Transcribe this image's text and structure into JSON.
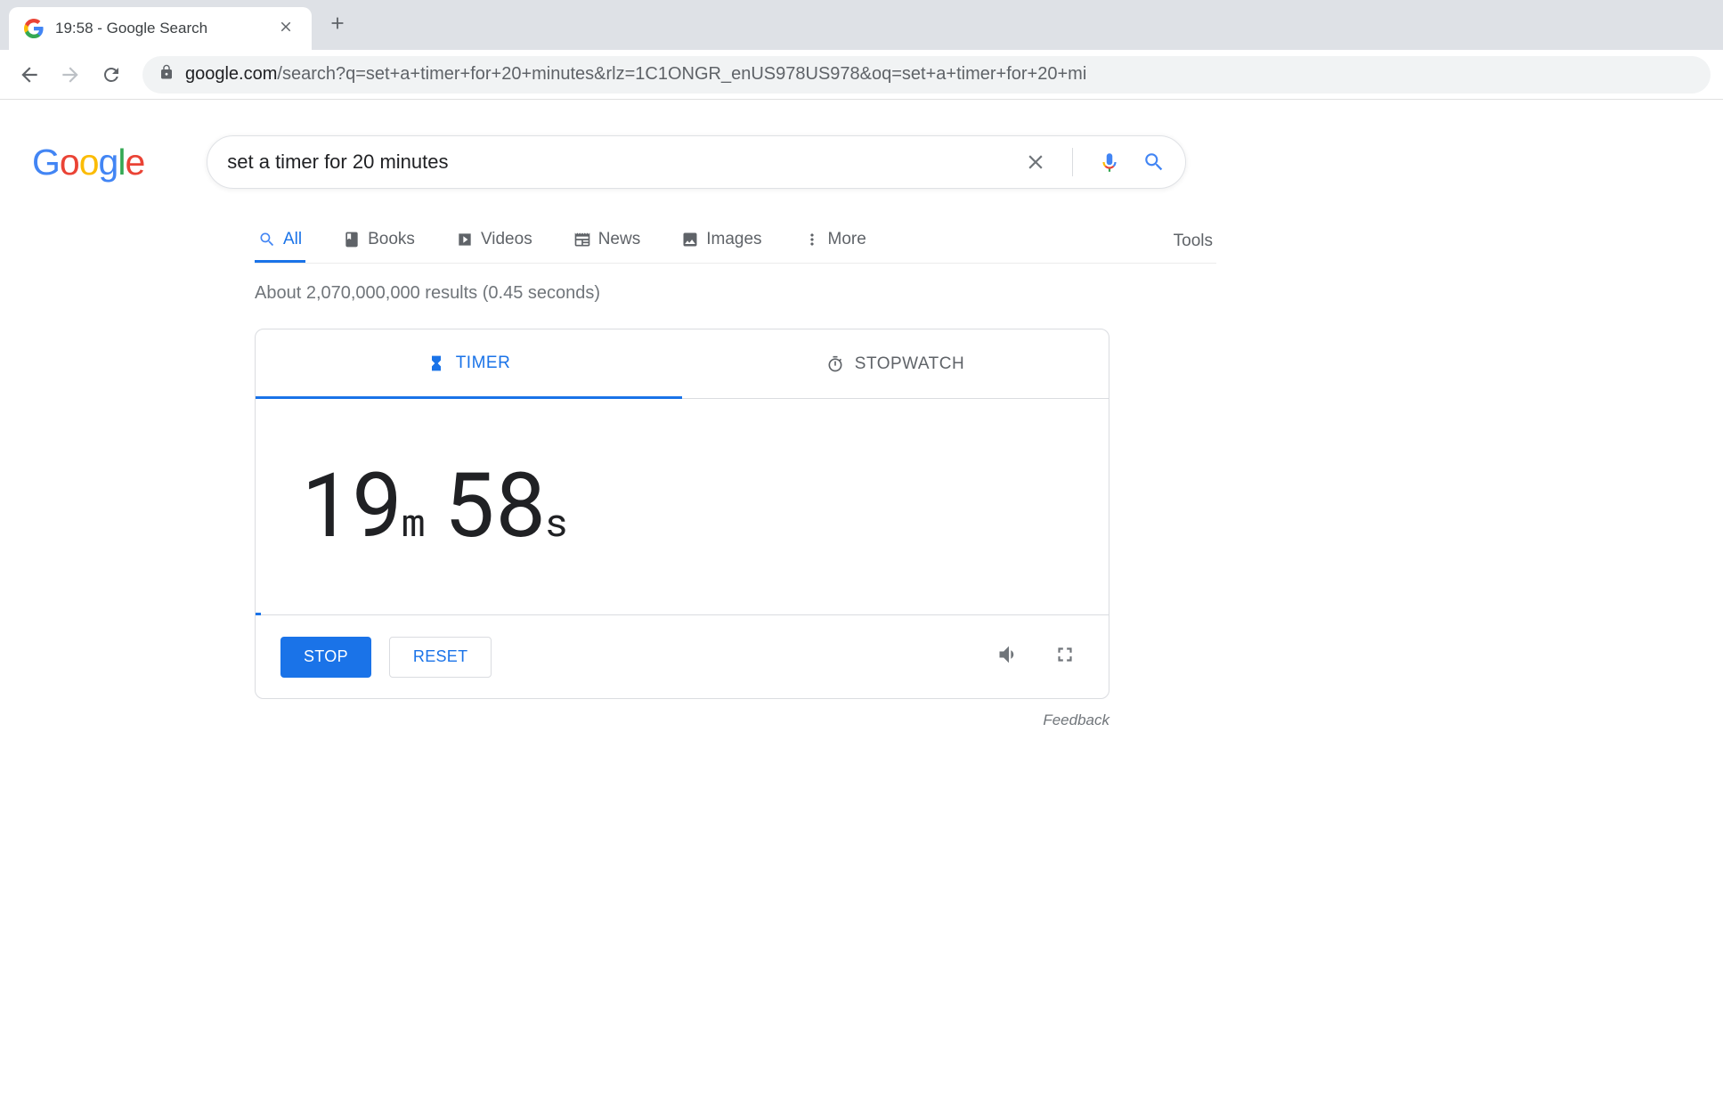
{
  "browser": {
    "tab_title": "19:58 - Google Search",
    "url_domain": "google.com",
    "url_path": "/search?q=set+a+timer+for+20+minutes&rlz=1C1ONGR_enUS978US978&oq=set+a+timer+for+20+mi"
  },
  "search": {
    "query": "set a timer for 20 minutes"
  },
  "tabs": {
    "all": "All",
    "books": "Books",
    "videos": "Videos",
    "news": "News",
    "images": "Images",
    "more": "More",
    "tools": "Tools"
  },
  "results_count": "About 2,070,000,000 results (0.45 seconds)",
  "timer": {
    "tab_timer": "TIMER",
    "tab_stopwatch": "STOPWATCH",
    "minutes": "19",
    "minutes_unit": "m",
    "seconds": "58",
    "seconds_unit": "s",
    "stop_label": "STOP",
    "reset_label": "RESET"
  },
  "feedback_label": "Feedback"
}
